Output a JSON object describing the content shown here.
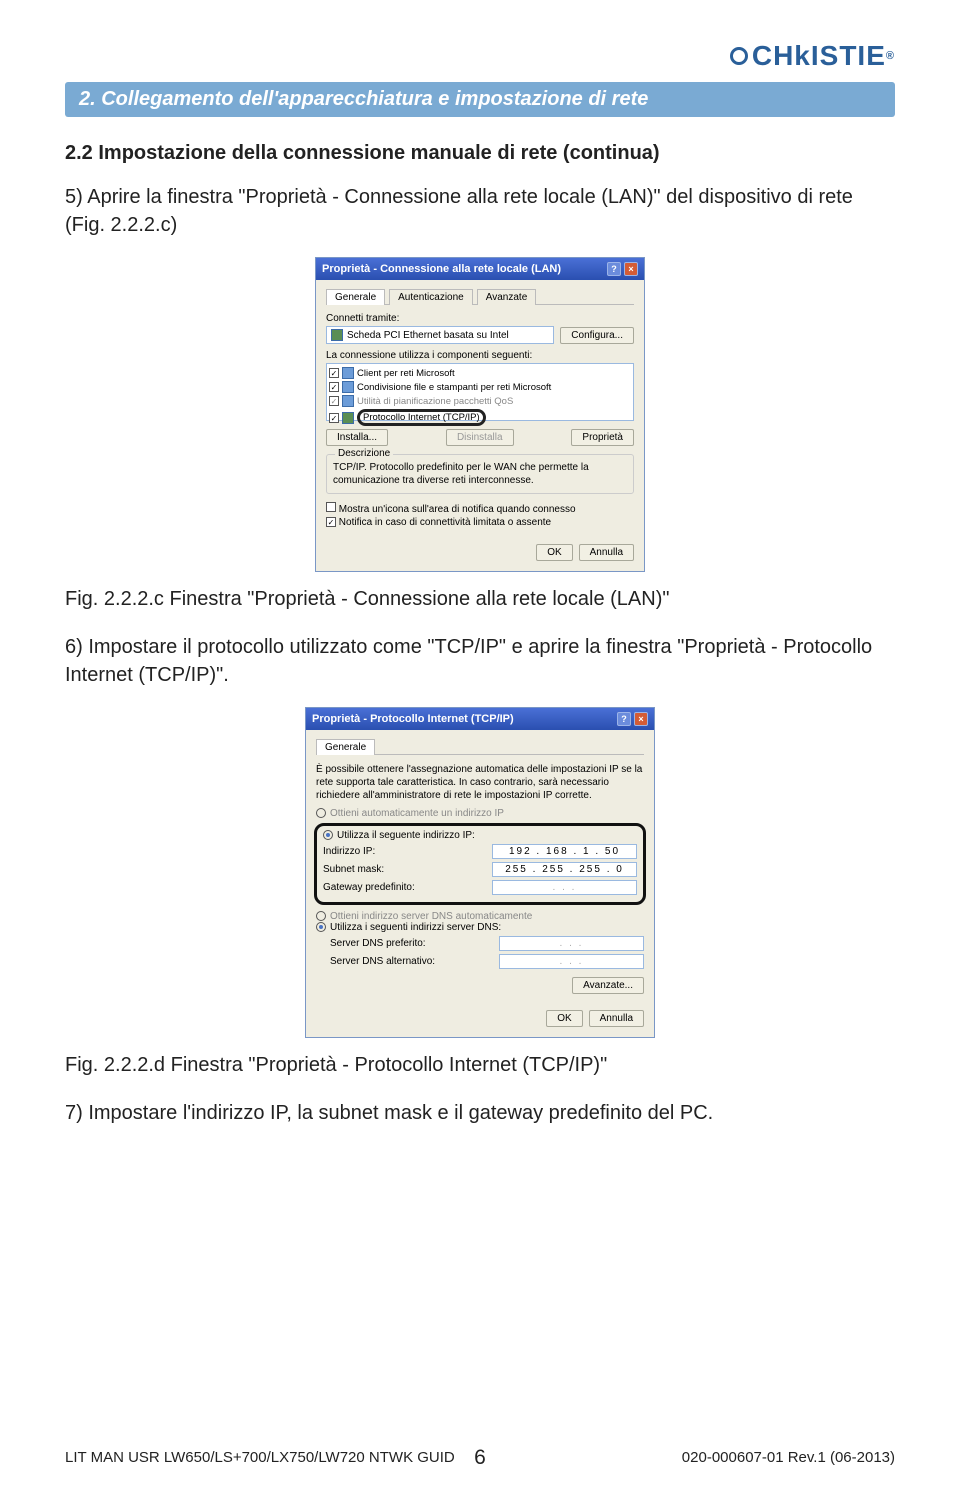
{
  "logo": {
    "text": "CHkISTIE",
    "reg": "®"
  },
  "section_title": "2. Collegamento dell'apparecchiatura e impostazione di rete",
  "sub_heading": "2.2 Impostazione della connessione manuale di rete (continua)",
  "body1": "5) Aprire la finestra \"Proprietà - Connessione alla rete locale (LAN)\" del dispositivo di rete (Fig. 2.2.2.c)",
  "fig1_caption": "Fig. 2.2.2.c Finestra \"Proprietà - Connessione alla rete locale (LAN)\"",
  "body2": "6) Impostare il protocollo utilizzato come \"TCP/IP\" e aprire la finestra \"Proprietà - Protocollo Internet (TCP/IP)\".",
  "fig2_caption": "Fig. 2.2.2.d Finestra \"Proprietà - Protocollo Internet (TCP/IP)\"",
  "body3": "7) Impostare l'indirizzo IP, la subnet mask e il gateway predefinito del PC.",
  "win1": {
    "title": "Proprietà - Connessione alla rete locale (LAN)",
    "tabs": [
      "Generale",
      "Autenticazione",
      "Avanzate"
    ],
    "connect_label": "Connetti tramite:",
    "adapter": "Scheda PCI Ethernet basata su Intel",
    "configure": "Configura...",
    "uses_label": "La connessione utilizza i componenti seguenti:",
    "items": [
      "Client per reti Microsoft",
      "Condivisione file e stampanti per reti Microsoft",
      "Utilità di pianificazione pacchetti QoS",
      "Protocollo Internet (TCP/IP)"
    ],
    "install": "Installa...",
    "uninstall": "Disinstalla",
    "props": "Proprietà",
    "desc_legend": "Descrizione",
    "desc_text": "TCP/IP. Protocollo predefinito per le WAN che permette la comunicazione tra diverse reti interconnesse.",
    "opt_show": "Mostra un'icona sull'area di notifica quando connesso",
    "opt_notify": "Notifica in caso di connettività limitata o assente",
    "ok": "OK",
    "cancel": "Annulla"
  },
  "win2": {
    "title": "Proprietà - Protocollo Internet (TCP/IP)",
    "tab": "Generale",
    "intro": "È possibile ottenere l'assegnazione automatica delle impostazioni IP se la rete supporta tale caratteristica. In caso contrario, sarà necessario richiedere all'amministratore di rete le impostazioni IP corrette.",
    "opt_auto_ip": "Ottieni automaticamente un indirizzo IP",
    "opt_man_ip": "Utilizza il seguente indirizzo IP:",
    "ip_label": "Indirizzo IP:",
    "ip_val": "192 . 168 .   1 .  50",
    "mask_label": "Subnet mask:",
    "mask_val": "255 . 255 . 255 .   0",
    "gw_label": "Gateway predefinito:",
    "gw_val": ".       .       .",
    "opt_auto_dns": "Ottieni indirizzo server DNS automaticamente",
    "opt_man_dns": "Utilizza i seguenti indirizzi server DNS:",
    "dns1_label": "Server DNS preferito:",
    "dns2_label": "Server DNS alternativo:",
    "adv": "Avanzate...",
    "ok": "OK",
    "cancel": "Annulla"
  },
  "footer": {
    "left": "LIT MAN USR LW650/LS+700/LX750/LW720 NTWK GUID",
    "center": "6",
    "right": "020-000607-01 Rev.1 (06-2013)"
  }
}
